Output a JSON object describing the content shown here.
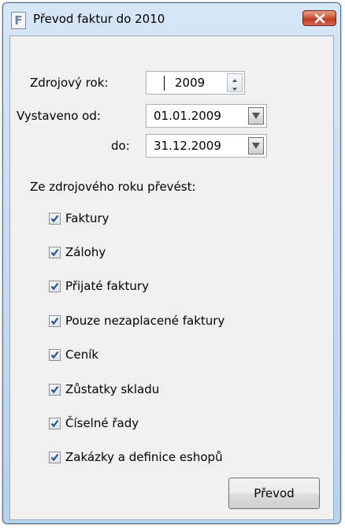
{
  "window": {
    "title": "Převod faktur do 2010",
    "app_icon_letter": "F",
    "icons": {
      "app": "app-f-icon",
      "close": "close-icon"
    }
  },
  "form": {
    "source_year_label": "Zdrojový rok:",
    "source_year_value": "2009",
    "issued_from_label": "Vystaveno od:",
    "issued_from_value": "01.01.2009",
    "issued_to_label": "do:",
    "issued_to_value": "31.12.2009",
    "section_label": "Ze zdrojového roku převést:"
  },
  "checkboxes": [
    {
      "label": "Faktury",
      "checked": true
    },
    {
      "label": "Zálohy",
      "checked": true
    },
    {
      "label": "Přijaté faktury",
      "checked": true
    },
    {
      "label": "Pouze nezaplacené faktury",
      "checked": true
    },
    {
      "label": "Ceník",
      "checked": true
    },
    {
      "label": "Zůstatky skladu",
      "checked": true
    },
    {
      "label": "Číselné řady",
      "checked": true
    },
    {
      "label": "Zakázky a definice eshopů",
      "checked": true
    }
  ],
  "buttons": {
    "convert_label": "Převod"
  },
  "colors": {
    "client_bg": "#f0f0f0",
    "frame": "#b9d0ea",
    "close": "#c85438",
    "check": "#2a4f8c"
  }
}
